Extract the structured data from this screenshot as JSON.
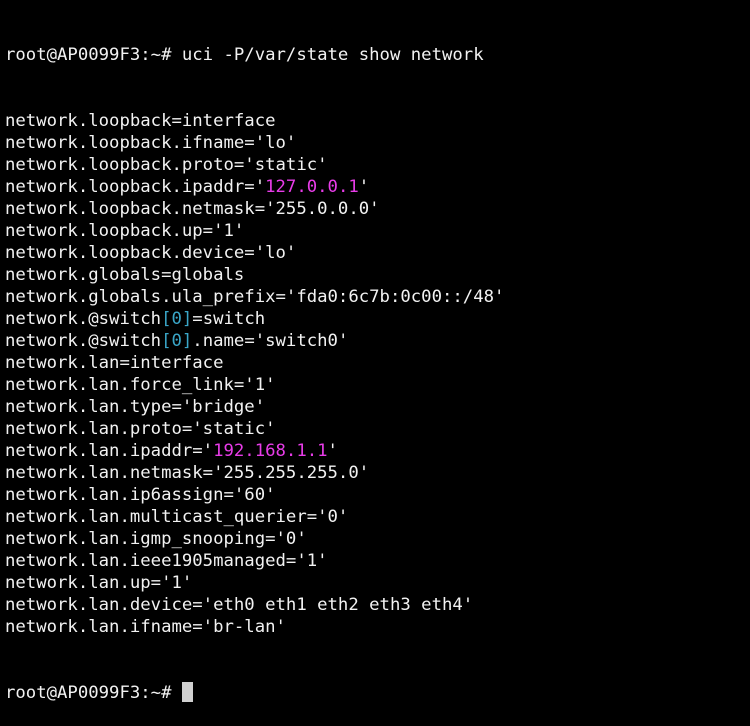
{
  "terminal": {
    "command_line": "root@AP0099F3:~# uci -P/var/state show network",
    "lines": [
      "network.loopback=interface",
      "network.loopback.ifname='lo'",
      "network.loopback.proto='static'",
      {
        "pre": "network.loopback.ipaddr='",
        "ip": "127.0.0.1",
        "post": "'"
      },
      "network.loopback.netmask='255.0.0.0'",
      "network.loopback.up='1'",
      "network.loopback.device='lo'",
      "network.globals=globals",
      "network.globals.ula_prefix='fda0:6c7b:0c00::/48'",
      {
        "pre": "network.@switch",
        "idx": "[0]",
        "post": "=switch"
      },
      {
        "pre": "network.@switch",
        "idx": "[0]",
        "post": ".name='switch0'"
      },
      "network.lan=interface",
      "network.lan.force_link='1'",
      "network.lan.type='bridge'",
      "network.lan.proto='static'",
      {
        "pre": "network.lan.ipaddr='",
        "ip": "192.168.1.1",
        "post": "'"
      },
      "network.lan.netmask='255.255.255.0'",
      "network.lan.ip6assign='60'",
      "network.lan.multicast_querier='0'",
      "network.lan.igmp_snooping='0'",
      "network.lan.ieee1905managed='1'",
      "network.lan.up='1'",
      "network.lan.device='eth0 eth1 eth2 eth3 eth4'",
      "network.lan.ifname='br-lan'"
    ],
    "prompt": "root@AP0099F3:~# ",
    "colors": {
      "background": "#000000",
      "text": "#f2f2f2",
      "ip_highlight": "#e83ce8",
      "index_highlight": "#3aa6c8",
      "cursor": "#d0d0d0"
    }
  }
}
